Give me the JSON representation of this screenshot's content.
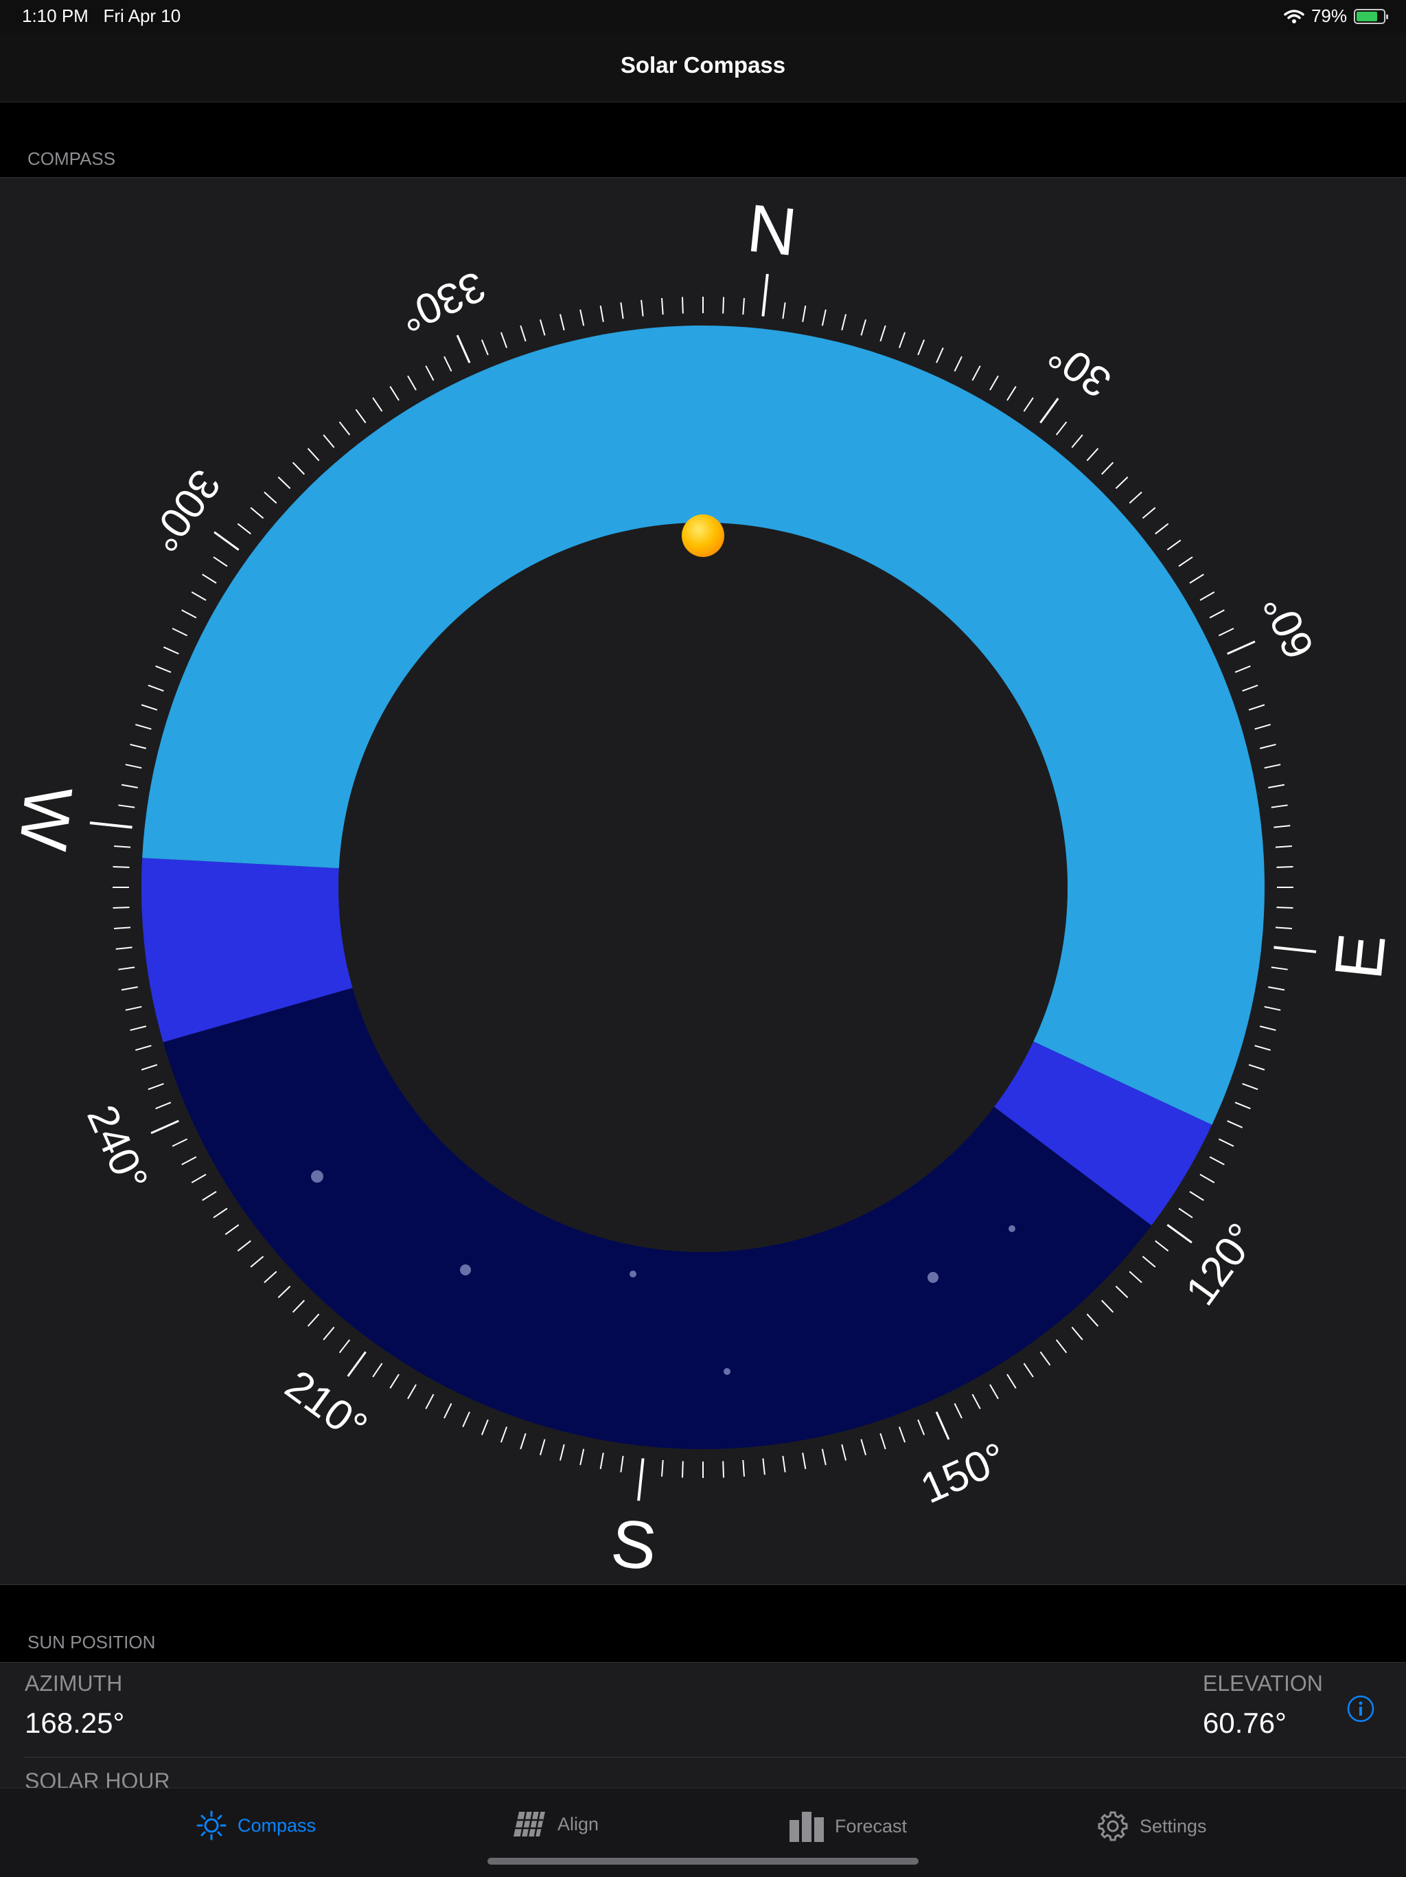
{
  "status_bar": {
    "time": "1:10 PM",
    "date": "Fri Apr 10",
    "battery_text": "79%",
    "battery_level": 0.79,
    "charging": true
  },
  "nav": {
    "title": "Solar Compass"
  },
  "compass_section": {
    "header": "COMPASS",
    "cardinals": [
      "S",
      "E",
      "W",
      "N"
    ],
    "degree_labels": [
      "150°",
      "120°",
      "210°",
      "240°",
      "60°",
      "30°",
      "300°",
      "330°"
    ],
    "colors": {
      "day": "#29a3e2",
      "twilight": "#2a31e2",
      "night": "#020951",
      "sun": "#ffb000"
    }
  },
  "sun_position": {
    "header": "SUN POSITION",
    "azimuth_label": "AZIMUTH",
    "azimuth_value": "168.25°",
    "elevation_label": "ELEVATION",
    "elevation_value": "60.76°",
    "solar_hour_label": "SOLAR HOUR"
  },
  "tabs": [
    {
      "label": "Compass",
      "icon": "sun-icon",
      "active": true
    },
    {
      "label": "Align",
      "icon": "solar-panel-icon",
      "active": false
    },
    {
      "label": "Forecast",
      "icon": "bar-chart-icon",
      "active": false
    },
    {
      "label": "Settings",
      "icon": "gear-icon",
      "active": false
    }
  ],
  "accent_color": "#0a84ff"
}
